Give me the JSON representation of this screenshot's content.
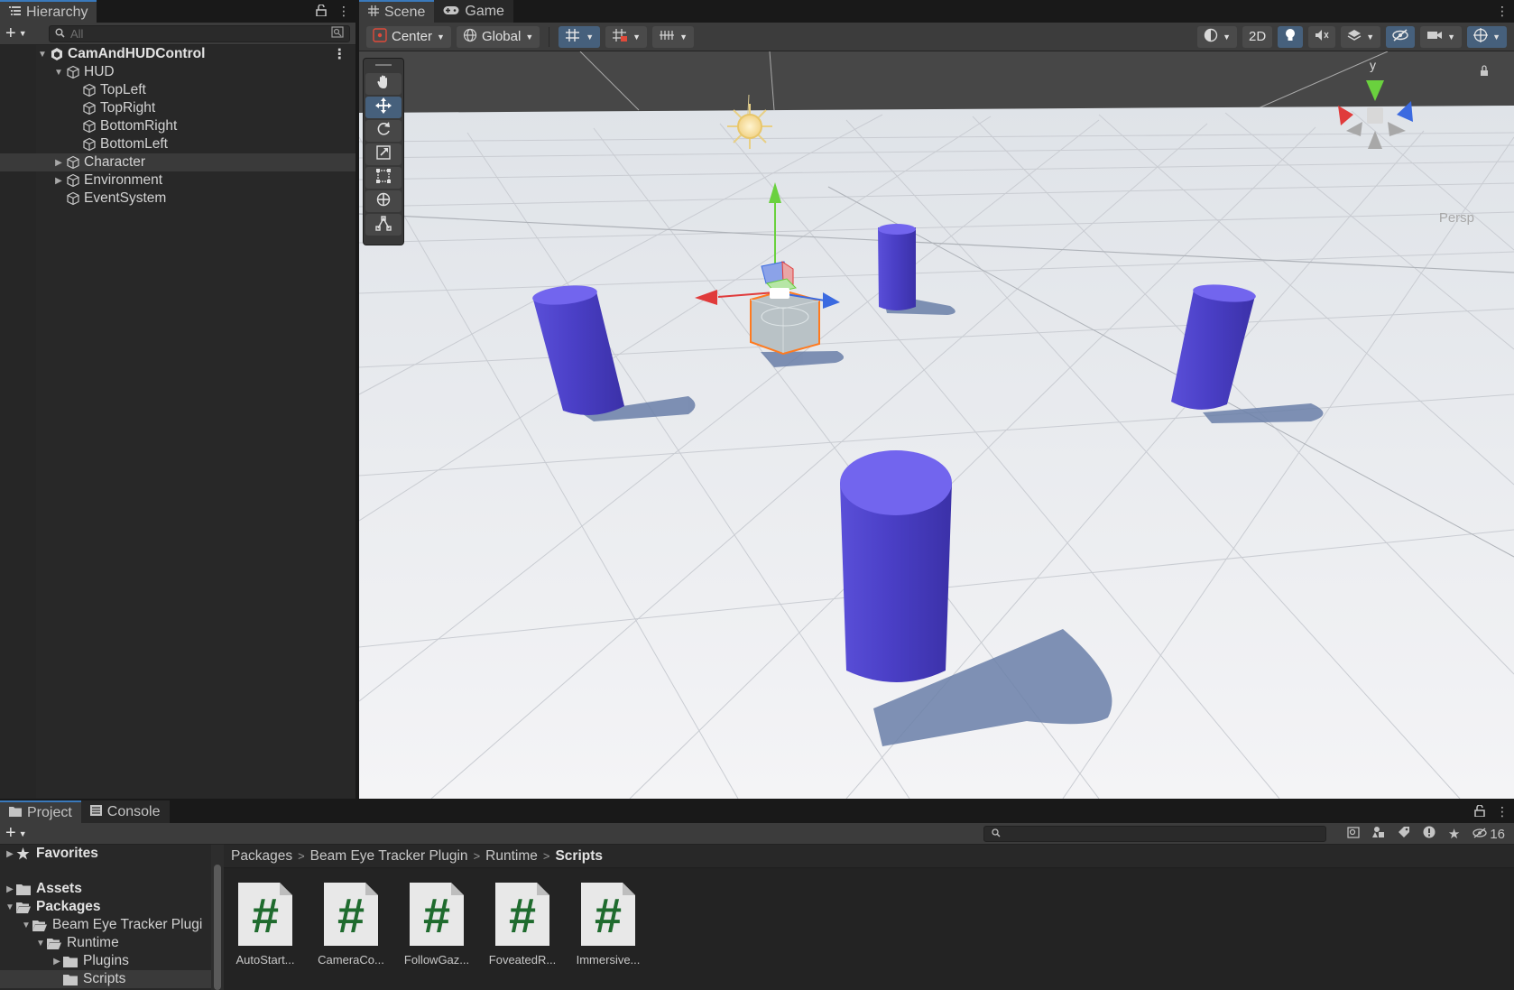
{
  "hierarchy": {
    "tab_label": "Hierarchy",
    "search_placeholder": "All",
    "scene_root": "CamAndHUDControl",
    "items": [
      {
        "label": "HUD"
      },
      {
        "label": "TopLeft"
      },
      {
        "label": "TopRight"
      },
      {
        "label": "BottomRight"
      },
      {
        "label": "BottomLeft"
      },
      {
        "label": "Character"
      },
      {
        "label": "Environment"
      },
      {
        "label": "EventSystem"
      }
    ]
  },
  "scene": {
    "tabs": [
      {
        "label": "Scene",
        "icon": "grid-icon"
      },
      {
        "label": "Game",
        "icon": "gamepad-icon"
      }
    ],
    "toolbar": {
      "pivot_label": "Center",
      "space_label": "Global",
      "mode_2d_label": "2D"
    },
    "gizmo": {
      "axis_label": "y",
      "projection_label": "Persp"
    },
    "colors": {
      "cylinder": "#5b4fe6",
      "selection_outline": "#ff7a1f",
      "axis_x": "#e03b3b",
      "axis_y": "#6ad13e",
      "axis_z": "#3b6ae0"
    }
  },
  "project": {
    "tabs": [
      {
        "label": "Project",
        "icon": "folder-icon"
      },
      {
        "label": "Console",
        "icon": "console-icon"
      }
    ],
    "hidden_count": "16",
    "tree": [
      {
        "label": "Favorites",
        "icon": "star-icon"
      },
      {
        "label": "Assets",
        "icon": "folder-icon"
      },
      {
        "label": "Packages",
        "icon": "folder-icon"
      },
      {
        "label": "Beam Eye Tracker Plugi",
        "icon": "folder-icon"
      },
      {
        "label": "Runtime",
        "icon": "folder-icon"
      },
      {
        "label": "Plugins",
        "icon": "folder-icon"
      },
      {
        "label": "Scripts",
        "icon": "folder-icon"
      }
    ],
    "breadcrumb": [
      "Packages",
      "Beam Eye Tracker Plugin",
      "Runtime",
      "Scripts"
    ],
    "files": [
      {
        "label": "AutoStart..."
      },
      {
        "label": "CameraCo..."
      },
      {
        "label": "FollowGaz..."
      },
      {
        "label": "FoveatedR..."
      },
      {
        "label": "Immersive..."
      }
    ]
  }
}
